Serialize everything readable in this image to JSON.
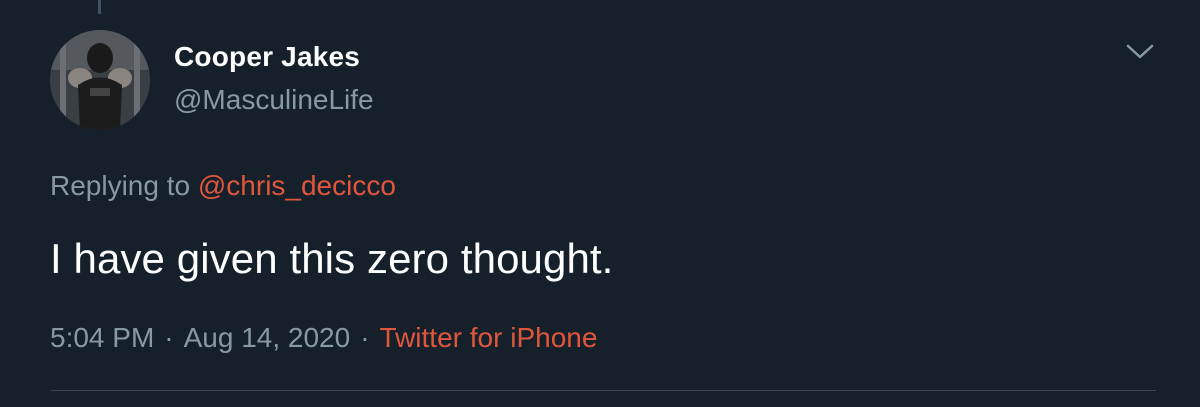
{
  "tweet": {
    "author": {
      "display_name": "Cooper Jakes",
      "handle": "@MasculineLife"
    },
    "replying_to": {
      "prefix": "Replying to",
      "mention": "@chris_decicco"
    },
    "text": "I have given this zero thought.",
    "meta": {
      "time": "5:04 PM",
      "separator": "·",
      "date": "Aug 14, 2020",
      "source": "Twitter for iPhone"
    }
  },
  "colors": {
    "background": "#15202b",
    "primary_text": "#ffffff",
    "secondary_text": "#8899a6",
    "accent": "#e0563a",
    "divider": "#38444d"
  },
  "icons": {
    "more": "chevron-down-icon",
    "avatar": "avatar"
  }
}
